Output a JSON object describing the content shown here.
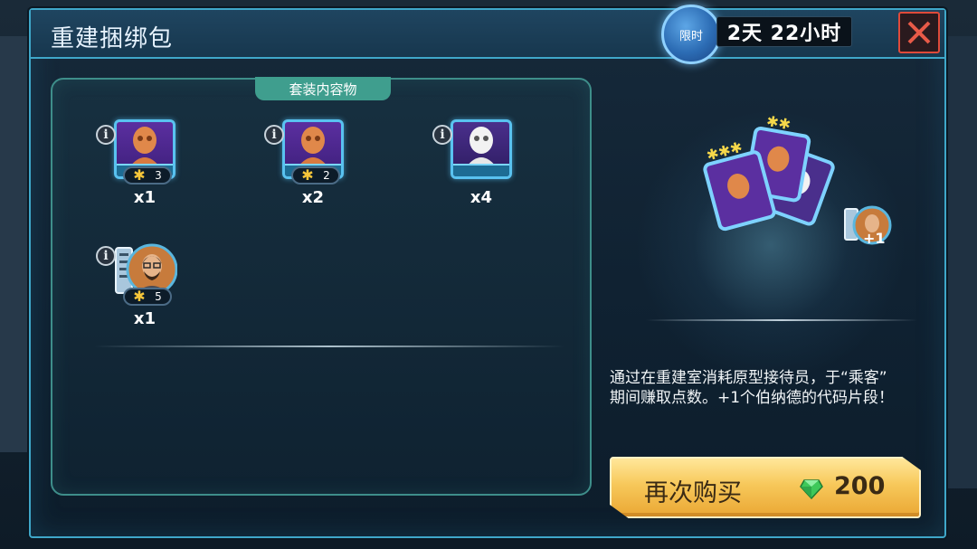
{
  "modal": {
    "title": "重建捆绑包",
    "timer_badge": "限时",
    "timer_value": "2天 22小时"
  },
  "contents": {
    "tab_label": "套装内容物",
    "items": [
      {
        "type": "prototype-receptionist",
        "color": "#e0884a",
        "stars": "3",
        "quantity": "x1"
      },
      {
        "type": "prototype-receptionist",
        "color": "#e0884a",
        "stars": "2",
        "quantity": "x2"
      },
      {
        "type": "prototype-receptionist",
        "color": "#f2f2f2",
        "stars": "",
        "quantity": "x4"
      },
      {
        "type": "bernard-code-fragment",
        "color": "#c77b3c",
        "stars": "5",
        "quantity": "x1"
      }
    ]
  },
  "right": {
    "description_line1": "通过在重建室消耗原型接待员，于“乘客”",
    "description_line2": "期间赚取点数。+1个伯纳德的代码片段！",
    "art_bonus": "+1",
    "buy_label": "再次购买",
    "price": "200",
    "price_icon": "gem-icon"
  },
  "colors": {
    "frame": "#3fa7c9",
    "panel_border": "#3e8e8a",
    "tab": "#3f9e8e",
    "close": "#e04a3a",
    "button": "#f7c85a",
    "gem": "#3ec85a"
  }
}
